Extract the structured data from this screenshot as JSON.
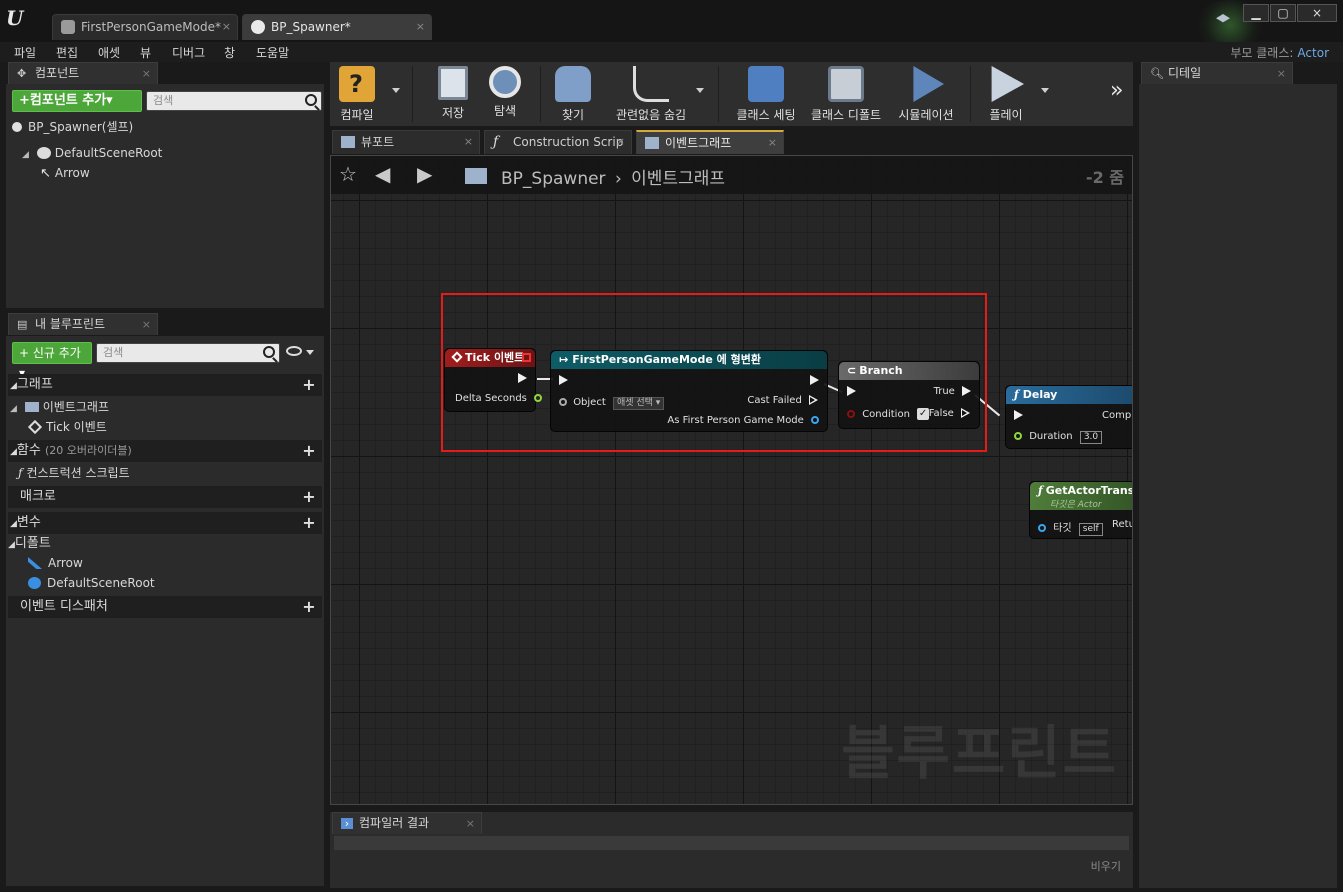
{
  "title_bar": {
    "tabs": [
      {
        "label": "FirstPersonGameMode*"
      },
      {
        "label": "BP_Spawner*"
      }
    ],
    "close_glyph": "×"
  },
  "menu": {
    "items": [
      "파일",
      "편집",
      "애셋",
      "뷰",
      "디버그",
      "창",
      "도움말"
    ],
    "parent_class_label": "부모 클래스:",
    "parent_class_value": "Actor"
  },
  "components_panel": {
    "tab_label": "컴포넌트",
    "add_button": "+컴포넌트 추가▾",
    "search_placeholder": "검색",
    "self_item": "BP_Spawner(셀프)",
    "tree": [
      "DefaultSceneRoot",
      "Arrow"
    ]
  },
  "my_blueprint_panel": {
    "tab_label": "내 블루프린트",
    "add_button": "+ 신규 추가 ▾",
    "search_placeholder": "검색",
    "sections": {
      "graphs": "그래프",
      "event_graph": "이벤트그래프",
      "tick_event": "Tick 이벤트",
      "functions": "함수",
      "functions_sub": "(20 오버라이더블)",
      "construction_script": "컨스트럭션 스크립트",
      "macros": "매크로",
      "variables": "변수",
      "defaults": "디폴트",
      "defaults_items": [
        "Arrow",
        "DefaultSceneRoot"
      ],
      "event_dispatchers": "이벤트 디스패처"
    }
  },
  "toolbar": {
    "buttons": [
      {
        "label": "컴파일",
        "icon": "compile-icon"
      },
      {
        "label": "저장",
        "icon": "save-icon"
      },
      {
        "label": "탐색",
        "icon": "browse-icon"
      },
      {
        "label": "찾기",
        "icon": "binoculars-icon"
      },
      {
        "label": "관련없음 숨김",
        "icon": "hide-unrelated-icon"
      },
      {
        "label": "클래스 세팅",
        "icon": "class-settings-icon"
      },
      {
        "label": "클래스 디폴트",
        "icon": "class-defaults-icon"
      },
      {
        "label": "시뮬레이션",
        "icon": "simulation-icon"
      },
      {
        "label": "플레이",
        "icon": "play-icon"
      }
    ],
    "overflow": "»"
  },
  "graph_tabs": [
    {
      "label": "뷰포트"
    },
    {
      "label": "Construction Scrip"
    },
    {
      "label": "이벤트그래프"
    }
  ],
  "graph": {
    "breadcrumb_root": "BP_Spawner",
    "breadcrumb_sep": "›",
    "breadcrumb_current": "이벤트그래프",
    "zoom": "-2 줌",
    "watermark": "블루프린트",
    "nodes": {
      "tick": {
        "title": "Tick 이벤트",
        "delta": "Delta Seconds"
      },
      "cast": {
        "title": "FirstPersonGameMode 에 형변환",
        "object": "Object",
        "object_value": "애셋 선택 ▾",
        "cast_failed": "Cast Failed",
        "as_mode": "As First Person Game Mode"
      },
      "branch": {
        "title": "Branch",
        "condition": "Condition",
        "true": "True",
        "false": "False"
      },
      "delay": {
        "title": "Delay",
        "completed": "Comple",
        "duration": "Duration",
        "duration_value": "3.0"
      },
      "get_transform": {
        "title": "GetActorTransform",
        "subtitle": "타깃은 Actor",
        "target": "타깃",
        "target_value": "self",
        "return": "Retu"
      }
    },
    "colors": {
      "event_header": "#a11d1d",
      "cast_header": "#0e5c66",
      "branch_header": "#5a5a5a",
      "delay_header": "#2a6c9c",
      "pure_header": "#4f7d3a",
      "highlight": "#e41b1b"
    }
  },
  "details_panel": {
    "tab_label": "디테일"
  },
  "compiler_panel": {
    "tab_label": "컴파일러 결과",
    "clear_button": "비우기"
  }
}
